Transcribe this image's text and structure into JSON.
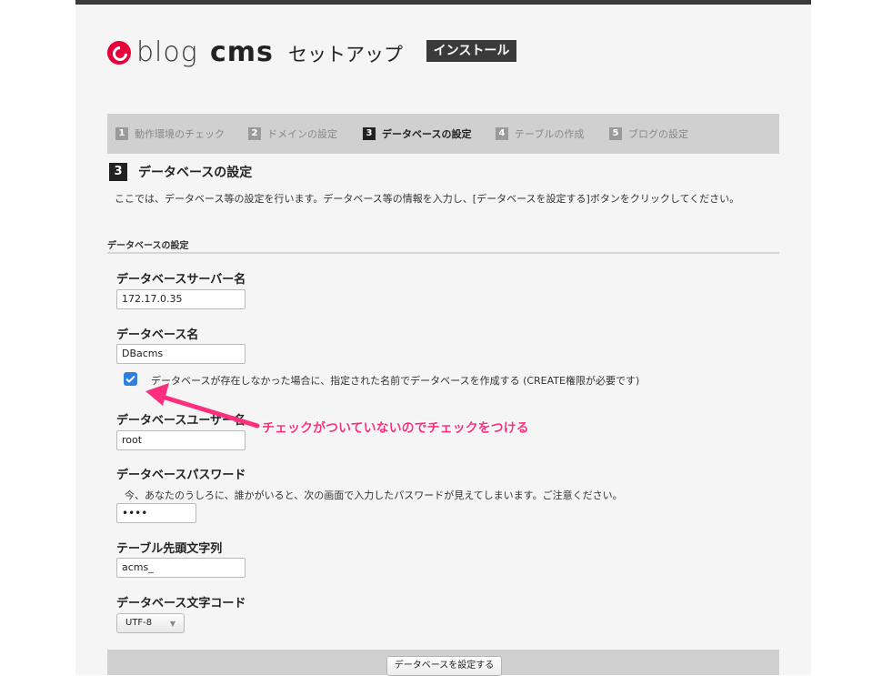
{
  "header": {
    "logo_blog": "blog",
    "logo_cms": "cms",
    "setup_title": "セットアップ",
    "install_badge": "インストール"
  },
  "steps": [
    {
      "num": "1",
      "label": "動作環境のチェック",
      "active": false
    },
    {
      "num": "2",
      "label": "ドメインの設定",
      "active": false
    },
    {
      "num": "3",
      "label": "データベースの設定",
      "active": true
    },
    {
      "num": "4",
      "label": "テーブルの作成",
      "active": false
    },
    {
      "num": "5",
      "label": "ブログの設定",
      "active": false
    }
  ],
  "section": {
    "num": "3",
    "title": "データベースの設定",
    "description": "ここでは、データベース等の設定を行います。データベース等の情報を入力し、[データベースを設定する]ボタンをクリックしてください。",
    "subsection": "データベースの設定"
  },
  "form": {
    "server_label": "データベースサーバー名",
    "server_value": "172.17.0.35",
    "dbname_label": "データベース名",
    "dbname_value": "DBacms",
    "create_checkbox_label": "データベースが存在しなかった場合に、指定された名前でデータベースを作成する (CREATE権限が必要です)",
    "create_checked": true,
    "user_label": "データベースユーザー名",
    "user_value": "root",
    "password_label": "データベースパスワード",
    "password_note": "今、あなたのうしろに、誰かがいると、次の画面で入力したパスワードが見えてしまいます。ご注意ください。",
    "password_value": "••••",
    "prefix_label": "テーブル先頭文字列",
    "prefix_value": "acms_",
    "charset_label": "データベース文字コード",
    "charset_value": "UTF-8",
    "submit_label": "データベースを設定する"
  },
  "annotation": {
    "text": "チェックがついていないのでチェックをつける",
    "color": "#ff2f7f"
  },
  "colors": {
    "checkbox": "#2d7fe2",
    "logo_red": "#e60039"
  }
}
